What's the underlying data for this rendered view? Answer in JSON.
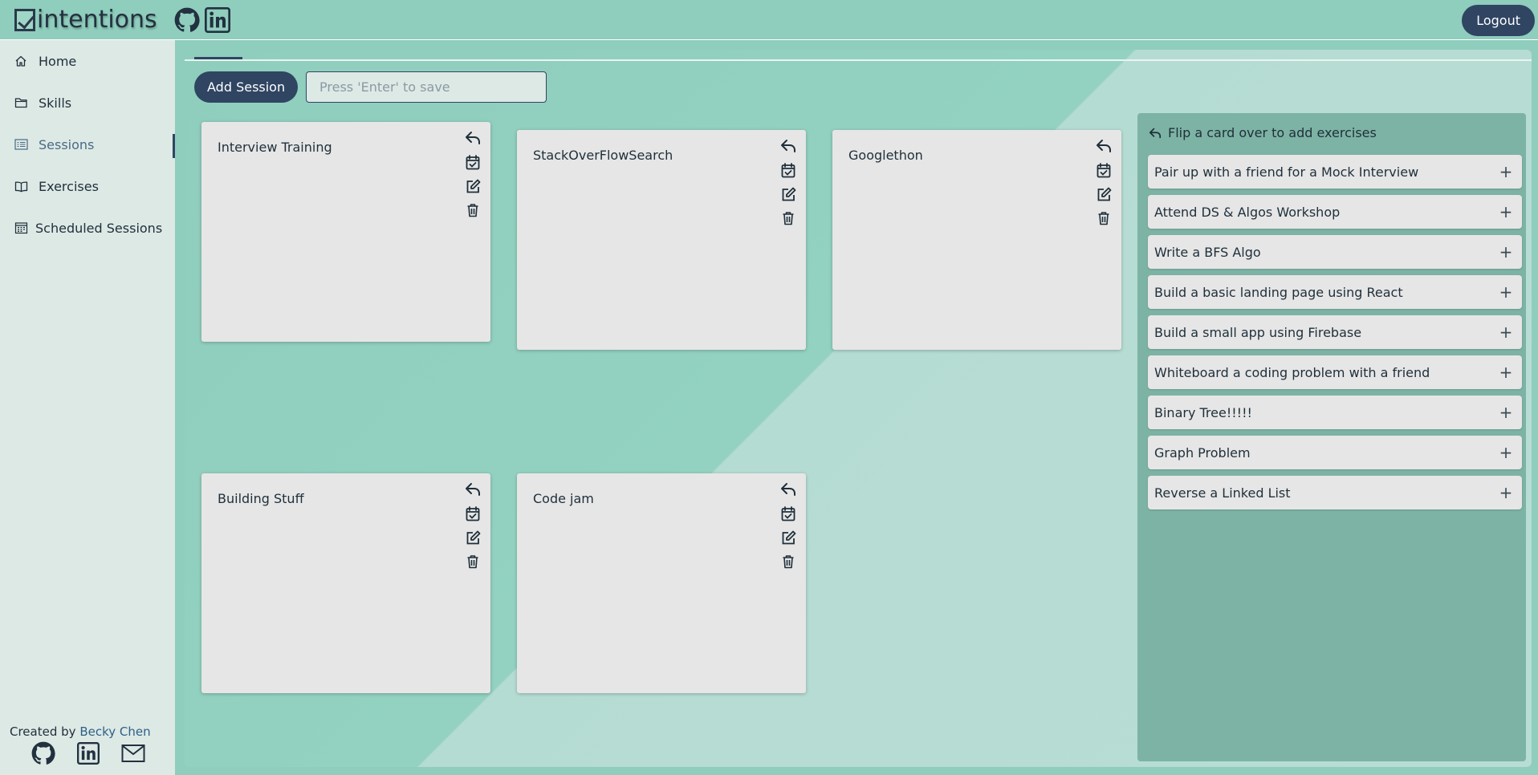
{
  "app": {
    "logo_text": "intentions",
    "logout_label": "Logout"
  },
  "sidebar": {
    "items": [
      {
        "label": "Home",
        "icon": "home-icon"
      },
      {
        "label": "Skills",
        "icon": "folder-icon"
      },
      {
        "label": "Sessions",
        "icon": "list-icon",
        "active": true
      },
      {
        "label": "Exercises",
        "icon": "book-icon"
      },
      {
        "label": "Scheduled Sessions",
        "icon": "calendar-icon"
      }
    ],
    "credit_prefix": "Created by",
    "credit_name": "Becky Chen"
  },
  "main": {
    "add_session_label": "Add Session",
    "input_placeholder": "Press 'Enter' to save",
    "sessions": [
      {
        "title": "Interview Training"
      },
      {
        "title": "StackOverFlowSearch"
      },
      {
        "title": "Googlethon"
      },
      {
        "title": "Building Stuff"
      },
      {
        "title": "Code jam"
      }
    ]
  },
  "exercises_panel": {
    "heading": "Flip a card over to add exercises",
    "items": [
      {
        "label": "Pair up with a friend for a Mock Interview"
      },
      {
        "label": "Attend DS & Algos Workshop"
      },
      {
        "label": "Write a BFS Algo"
      },
      {
        "label": "Build a basic landing page using React"
      },
      {
        "label": "Build a small app using Firebase"
      },
      {
        "label": "Whiteboard a coding problem with a friend"
      },
      {
        "label": "Binary Tree!!!!!"
      },
      {
        "label": "Graph Problem"
      },
      {
        "label": "Reverse a Linked List"
      }
    ]
  },
  "colors": {
    "teal": "#8fcdbd",
    "navy": "#2f4562",
    "card": "#e6e6e6",
    "panel": "#7db3a4",
    "sidebar": "#dde9e5"
  }
}
